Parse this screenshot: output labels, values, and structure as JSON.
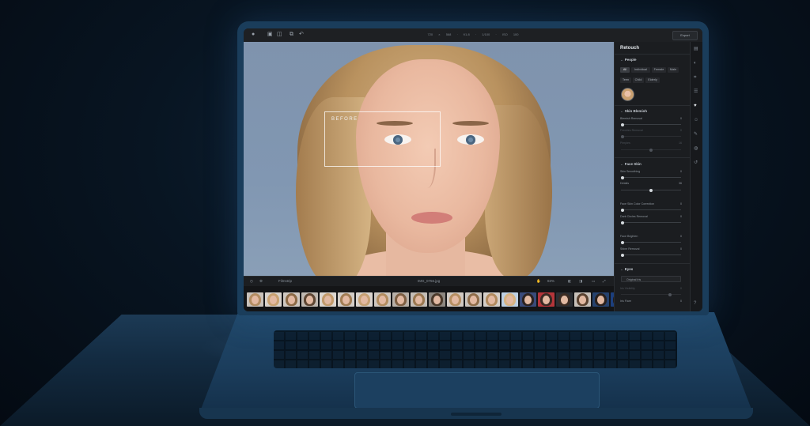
{
  "topbar": {
    "file_info": "720 × 568  ·  f/1.8  ·  1/100  ·  ISO 100",
    "export_label": "Export"
  },
  "canvas": {
    "before_label": "BEFORE",
    "bar_left": "Filmstrip",
    "filename": "IMG_0756.jpg",
    "zoom": "83%"
  },
  "panel": {
    "title": "Retouch",
    "people": {
      "heading": "People",
      "chips": [
        "All",
        "Individual",
        "Female",
        "Male",
        "Teen",
        "Child",
        "Elderly"
      ],
      "active_chip": "All"
    },
    "skin_blemish": {
      "heading": "Skin Blemish",
      "items": [
        {
          "label": "Blemish Removal",
          "value": "0"
        },
        {
          "label": "Freckles Removal",
          "value": "0"
        },
        {
          "label": "Pimples",
          "value": "16"
        }
      ]
    },
    "face_skin": {
      "heading": "Face Skin",
      "items": [
        {
          "label": "Skin Smoothing",
          "value": "0"
        },
        {
          "label": "Details",
          "value": "36"
        },
        {
          "label": "Face Skin Color Correction",
          "value": "0"
        },
        {
          "label": "Dark Circles Removal",
          "value": "0"
        },
        {
          "label": "Face Brighten",
          "value": "0"
        },
        {
          "label": "Shine Removal",
          "value": "0"
        }
      ]
    },
    "eyes": {
      "heading": "Eyes",
      "dropdown": "Original Iris",
      "items": [
        {
          "label": "Iris Visibility",
          "value": "0"
        },
        {
          "label": "Iris Flare",
          "value": "0"
        }
      ]
    }
  }
}
